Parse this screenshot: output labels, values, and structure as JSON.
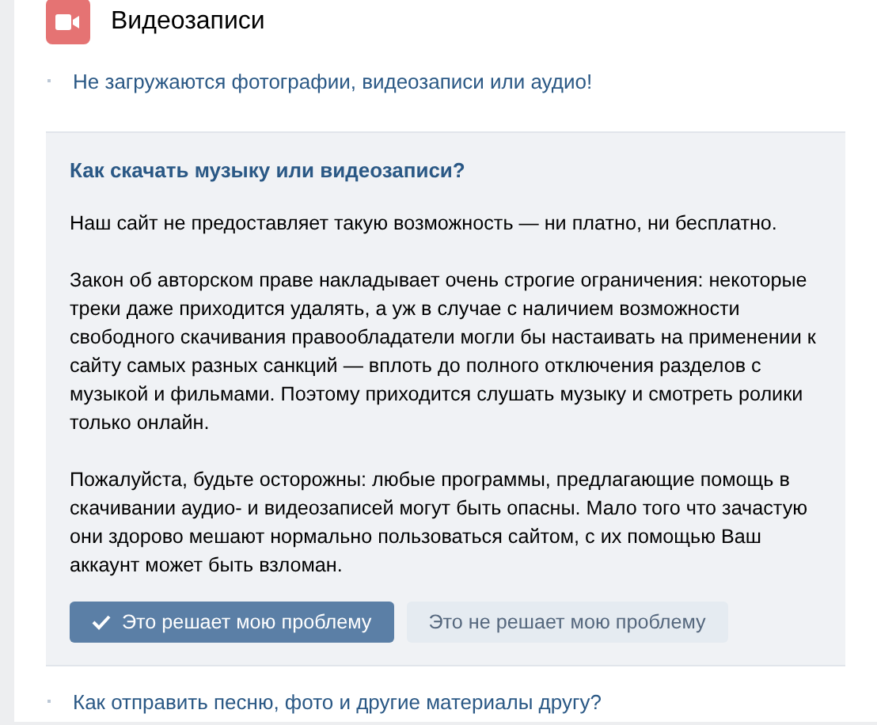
{
  "section": {
    "title": "Видеозаписи"
  },
  "faq_items": [
    {
      "question": "Не загружаются фотографии, видеозаписи или аудио!",
      "expanded": false
    },
    {
      "question": "Как скачать музыку или видеозаписи?",
      "expanded": true,
      "paragraphs": [
        "Наш сайт не предоставляет такую возможность — ни платно, ни бесплатно.",
        "Закон об авторском праве накладывает очень строгие ограничения: некоторые треки даже приходится удалять, а уж в случае с наличием возможности свободного скачивания правообладатели могли бы настаивать на применении к сайту самых разных санкций — вплоть до полного отключения разделов с музыкой и фильмами. Поэтому приходится слушать музыку и смотреть ролики только онлайн.",
        "Пожалуйста, будьте осторожны: любые программы, предлагающие помощь в скачивании аудио- и видеозаписей могут быть опасны. Мало того что зачастую они здорово мешают нормально пользоваться сайтом, с их помощью Ваш аккаунт может быть взломан."
      ],
      "buttons": [
        {
          "label": "Это решает мою проблему",
          "kind": "primary"
        },
        {
          "label": "Это не решает мою проблему",
          "kind": "secondary"
        }
      ]
    },
    {
      "question": "Как отправить песню, фото и другие материалы другу?",
      "expanded": false
    }
  ]
}
